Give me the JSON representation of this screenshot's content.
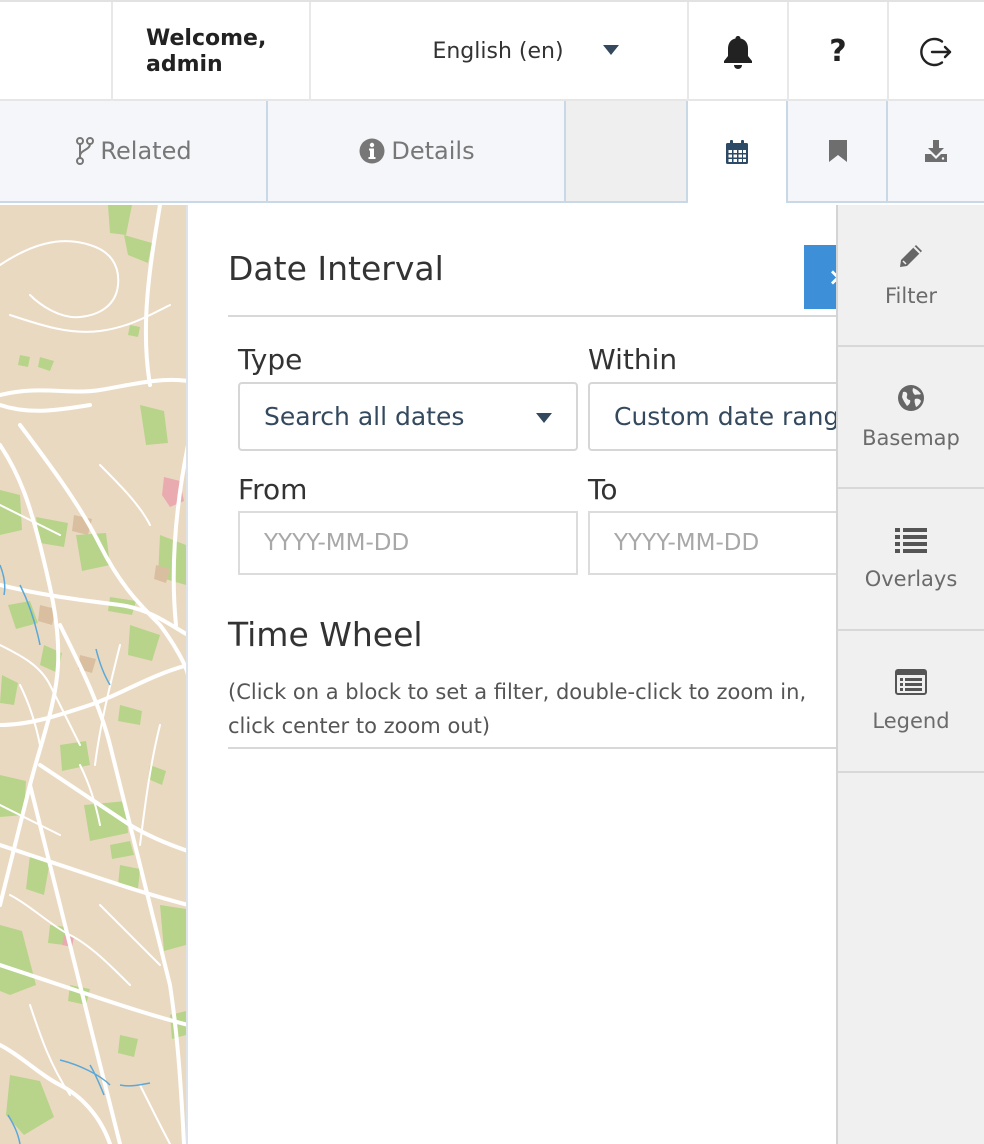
{
  "header": {
    "welcome_line1": "Welcome,",
    "welcome_line2": "admin",
    "language": "English (en)",
    "help_label": "?"
  },
  "tabs": [
    {
      "label": "Related",
      "icon": "branch-icon"
    },
    {
      "label": "Details",
      "icon": "info-circle-icon"
    },
    {
      "label": "",
      "icon": "calendar-icon"
    },
    {
      "label": "",
      "icon": "bookmark-icon"
    },
    {
      "label": "",
      "icon": "download-icon"
    }
  ],
  "date_interval": {
    "title": "Date Interval",
    "type_label": "Type",
    "type_value": "Search all dates",
    "within_label": "Within",
    "within_value": "Custom date range",
    "from_label": "From",
    "from_placeholder": "YYYY-MM-DD",
    "to_label": "To",
    "to_placeholder": "YYYY-MM-DD"
  },
  "time_wheel": {
    "title": "Time Wheel",
    "description": "(Click on a block to set a filter, double-click to zoom in, click center to zoom out)"
  },
  "sidebar": {
    "items": [
      {
        "label": "Filter",
        "icon": "pencil-icon"
      },
      {
        "label": "Basemap",
        "icon": "globe-icon"
      },
      {
        "label": "Overlays",
        "icon": "list-icon"
      },
      {
        "label": "Legend",
        "icon": "legend-icon"
      }
    ]
  },
  "colors": {
    "accent_blue": "#3d8fd8",
    "map_land": "#ead9c1",
    "map_park": "#b8d48a",
    "map_road": "#ffffff",
    "text_dark": "#34495e"
  }
}
